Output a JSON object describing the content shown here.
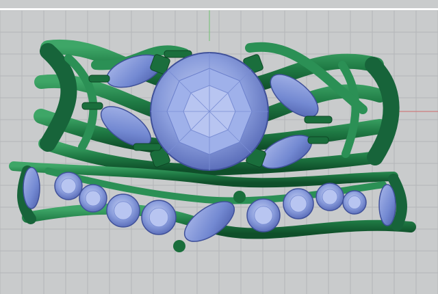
{
  "viewport": {
    "view_name": "",
    "background_color": "#c9cbcc",
    "grid_color": "#b4b6b8",
    "top_border_color": "#ffffff",
    "axis_x_color": "#d06a6a",
    "axis_y_color": "#6fbf6f"
  },
  "model": {
    "metal_color": "#1f7a44",
    "metal_dark": "#0f4f2a",
    "metal_light": "#3fa868",
    "gem_color": "#7b8fd6",
    "gem_light": "#aab8ea",
    "gem_dark": "#4a5ca8",
    "center_stone_icon": "round-gem-icon",
    "marquise_icon": "marquise-gem-icon",
    "accent_stone_icon": "round-accent-gem-icon"
  }
}
